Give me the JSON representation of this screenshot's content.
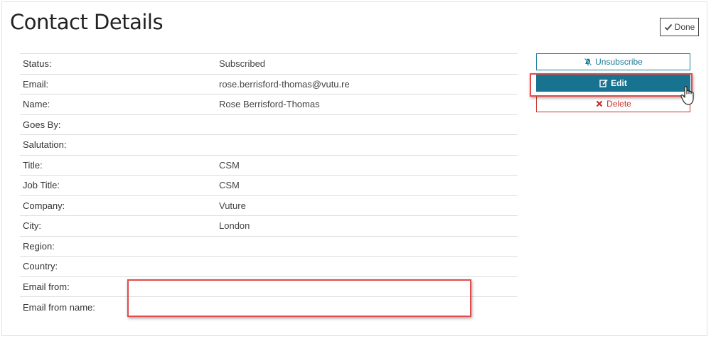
{
  "page": {
    "title": "Contact Details"
  },
  "header": {
    "done_label": "Done"
  },
  "details": {
    "rows": [
      {
        "label": "Status:",
        "value": "Subscribed"
      },
      {
        "label": "Email:",
        "value": "rose.berrisford-thomas@vutu.re"
      },
      {
        "label": "Name:",
        "value": "Rose Berrisford-Thomas"
      },
      {
        "label": "Goes By:",
        "value": ""
      },
      {
        "label": "Salutation:",
        "value": ""
      },
      {
        "label": "Title:",
        "value": "CSM"
      },
      {
        "label": "Job Title:",
        "value": "CSM"
      },
      {
        "label": "Company:",
        "value": "Vuture"
      },
      {
        "label": "City:",
        "value": "London"
      },
      {
        "label": "Region:",
        "value": ""
      },
      {
        "label": "Country:",
        "value": ""
      },
      {
        "label": "Email from:",
        "value": ""
      },
      {
        "label": "Email from name:",
        "value": ""
      }
    ]
  },
  "actions": {
    "unsubscribe_label": "Unsubscribe",
    "edit_label": "Edit",
    "delete_label": "Delete"
  },
  "colors": {
    "primary": "#17738f",
    "danger": "#c9302c",
    "highlight": "#e34a4a"
  }
}
